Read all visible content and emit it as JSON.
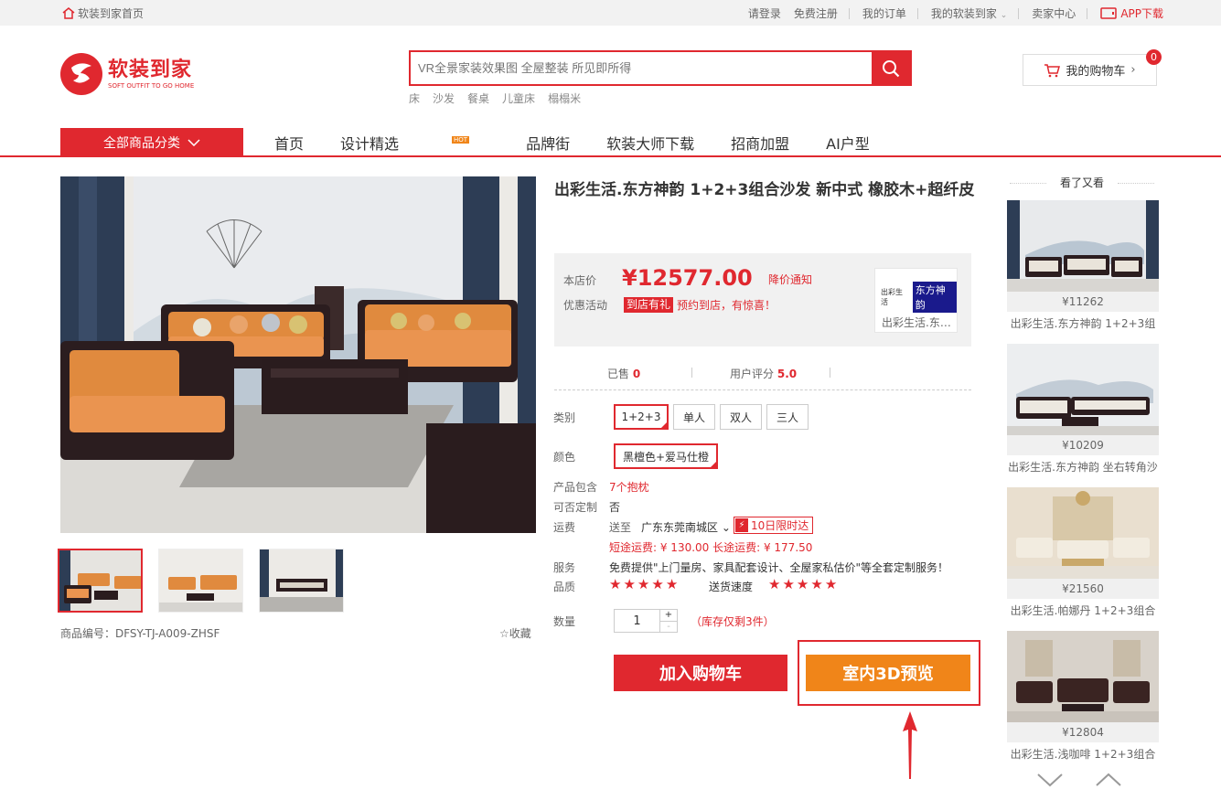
{
  "topbar": {
    "home": "软装到家首页",
    "login": "请登录",
    "register": "免费注册",
    "orders": "我的订单",
    "my_account": "我的软装到家",
    "seller": "卖家中心",
    "app": "APP下载"
  },
  "logo": {
    "cn": "软装到家",
    "en": "SOFT OUTFIT TO GO HOME"
  },
  "search": {
    "placeholder": "VR全景家装效果图 全屋整装 所见即所得",
    "hotwords": [
      "床",
      "沙发",
      "餐桌",
      "儿童床",
      "榻榻米"
    ]
  },
  "cart": {
    "label": "我的购物车",
    "count": "0"
  },
  "nav": {
    "all_categories": "全部商品分类",
    "links": [
      "首页",
      "设计精选",
      "品牌街",
      "软装大师下载",
      "招商加盟",
      "AI户型"
    ],
    "hot_badge": "HOT"
  },
  "product": {
    "title": "出彩生活.东方神韵 1+2+3组合沙发 新中式 橡胶木+超纤皮",
    "price_label": "本店价",
    "price": "¥12577.00",
    "price_notice": "降价通知",
    "promo_label": "优惠活动",
    "promo_tag": "到店有礼",
    "promo_text": "预约到店，有惊喜！",
    "shop_logo_small": "出彩生活",
    "shop_logo_brand": "东方神韵",
    "shop_name": "出彩生活.东…",
    "sold_label": "已售",
    "sold": "0",
    "rating_label": "用户评分",
    "rating": "5.0",
    "code": "商品编号：DFSY-TJ-A009-ZHSF",
    "collect": "收藏"
  },
  "options": {
    "category_label": "类别",
    "categories": [
      "1+2+3",
      "单人",
      "双人",
      "三人"
    ],
    "color_label": "颜色",
    "color": "黑檀色+爱马仕橙",
    "includes_label": "产品包含",
    "includes": "7个抱枕",
    "custom_label": "可否定制",
    "custom": "否",
    "shipping_label": "运费",
    "ship_to": "送至",
    "region": "广东东莞南城区",
    "delivery_badge": "10日限时达",
    "shipping_fee": "短途运费: ¥ 130.00 长途运费: ¥ 177.50",
    "service_label": "服务",
    "service": "免费提供\"上门量房、家具配套设计、全屋家私估价\"等全套定制服务！",
    "quality_label": "品质",
    "quality_stars": 5,
    "speed_label": "送货速度",
    "speed_stars": 5,
    "qty_label": "数量",
    "qty": "1",
    "plus": "+",
    "minus": "-",
    "stock": "（库存仅剩3件）"
  },
  "actions": {
    "add_cart": "加入购物车",
    "view_3d": "室内3D预览"
  },
  "sidebar": {
    "title": "看了又看",
    "items": [
      {
        "price": "¥11262",
        "name": "出彩生活.东方神韵 1+2+3组"
      },
      {
        "price": "¥10209",
        "name": "出彩生活.东方神韵 坐右转角沙"
      },
      {
        "price": "¥21560",
        "name": "出彩生活.帕娜丹 1+2+3组合"
      },
      {
        "price": "¥12804",
        "name": "出彩生活.浅咖啡 1+2+3组合"
      }
    ]
  },
  "colors": {
    "brand_red": "#e0282f",
    "orange": "#f08519"
  }
}
